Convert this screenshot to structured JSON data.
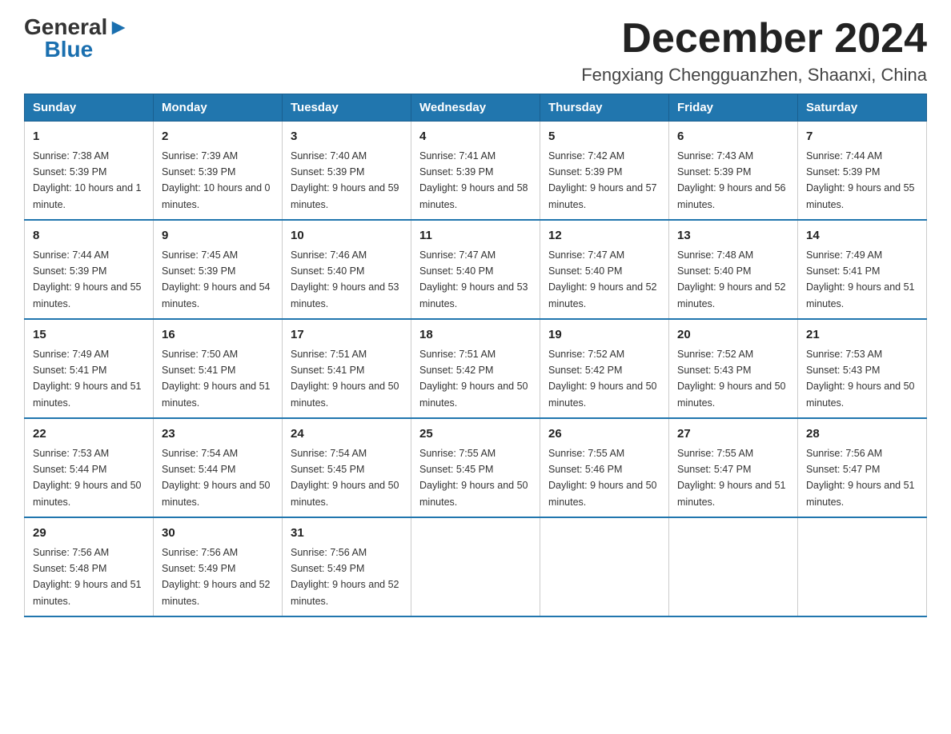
{
  "header": {
    "logo_general": "General",
    "logo_blue": "Blue",
    "month_title": "December 2024",
    "location": "Fengxiang Chengguanzhen, Shaanxi, China"
  },
  "columns": [
    "Sunday",
    "Monday",
    "Tuesday",
    "Wednesday",
    "Thursday",
    "Friday",
    "Saturday"
  ],
  "weeks": [
    [
      {
        "day": "1",
        "sunrise": "7:38 AM",
        "sunset": "5:39 PM",
        "daylight": "10 hours and 1 minute."
      },
      {
        "day": "2",
        "sunrise": "7:39 AM",
        "sunset": "5:39 PM",
        "daylight": "10 hours and 0 minutes."
      },
      {
        "day": "3",
        "sunrise": "7:40 AM",
        "sunset": "5:39 PM",
        "daylight": "9 hours and 59 minutes."
      },
      {
        "day": "4",
        "sunrise": "7:41 AM",
        "sunset": "5:39 PM",
        "daylight": "9 hours and 58 minutes."
      },
      {
        "day": "5",
        "sunrise": "7:42 AM",
        "sunset": "5:39 PM",
        "daylight": "9 hours and 57 minutes."
      },
      {
        "day": "6",
        "sunrise": "7:43 AM",
        "sunset": "5:39 PM",
        "daylight": "9 hours and 56 minutes."
      },
      {
        "day": "7",
        "sunrise": "7:44 AM",
        "sunset": "5:39 PM",
        "daylight": "9 hours and 55 minutes."
      }
    ],
    [
      {
        "day": "8",
        "sunrise": "7:44 AM",
        "sunset": "5:39 PM",
        "daylight": "9 hours and 55 minutes."
      },
      {
        "day": "9",
        "sunrise": "7:45 AM",
        "sunset": "5:39 PM",
        "daylight": "9 hours and 54 minutes."
      },
      {
        "day": "10",
        "sunrise": "7:46 AM",
        "sunset": "5:40 PM",
        "daylight": "9 hours and 53 minutes."
      },
      {
        "day": "11",
        "sunrise": "7:47 AM",
        "sunset": "5:40 PM",
        "daylight": "9 hours and 53 minutes."
      },
      {
        "day": "12",
        "sunrise": "7:47 AM",
        "sunset": "5:40 PM",
        "daylight": "9 hours and 52 minutes."
      },
      {
        "day": "13",
        "sunrise": "7:48 AM",
        "sunset": "5:40 PM",
        "daylight": "9 hours and 52 minutes."
      },
      {
        "day": "14",
        "sunrise": "7:49 AM",
        "sunset": "5:41 PM",
        "daylight": "9 hours and 51 minutes."
      }
    ],
    [
      {
        "day": "15",
        "sunrise": "7:49 AM",
        "sunset": "5:41 PM",
        "daylight": "9 hours and 51 minutes."
      },
      {
        "day": "16",
        "sunrise": "7:50 AM",
        "sunset": "5:41 PM",
        "daylight": "9 hours and 51 minutes."
      },
      {
        "day": "17",
        "sunrise": "7:51 AM",
        "sunset": "5:41 PM",
        "daylight": "9 hours and 50 minutes."
      },
      {
        "day": "18",
        "sunrise": "7:51 AM",
        "sunset": "5:42 PM",
        "daylight": "9 hours and 50 minutes."
      },
      {
        "day": "19",
        "sunrise": "7:52 AM",
        "sunset": "5:42 PM",
        "daylight": "9 hours and 50 minutes."
      },
      {
        "day": "20",
        "sunrise": "7:52 AM",
        "sunset": "5:43 PM",
        "daylight": "9 hours and 50 minutes."
      },
      {
        "day": "21",
        "sunrise": "7:53 AM",
        "sunset": "5:43 PM",
        "daylight": "9 hours and 50 minutes."
      }
    ],
    [
      {
        "day": "22",
        "sunrise": "7:53 AM",
        "sunset": "5:44 PM",
        "daylight": "9 hours and 50 minutes."
      },
      {
        "day": "23",
        "sunrise": "7:54 AM",
        "sunset": "5:44 PM",
        "daylight": "9 hours and 50 minutes."
      },
      {
        "day": "24",
        "sunrise": "7:54 AM",
        "sunset": "5:45 PM",
        "daylight": "9 hours and 50 minutes."
      },
      {
        "day": "25",
        "sunrise": "7:55 AM",
        "sunset": "5:45 PM",
        "daylight": "9 hours and 50 minutes."
      },
      {
        "day": "26",
        "sunrise": "7:55 AM",
        "sunset": "5:46 PM",
        "daylight": "9 hours and 50 minutes."
      },
      {
        "day": "27",
        "sunrise": "7:55 AM",
        "sunset": "5:47 PM",
        "daylight": "9 hours and 51 minutes."
      },
      {
        "day": "28",
        "sunrise": "7:56 AM",
        "sunset": "5:47 PM",
        "daylight": "9 hours and 51 minutes."
      }
    ],
    [
      {
        "day": "29",
        "sunrise": "7:56 AM",
        "sunset": "5:48 PM",
        "daylight": "9 hours and 51 minutes."
      },
      {
        "day": "30",
        "sunrise": "7:56 AM",
        "sunset": "5:49 PM",
        "daylight": "9 hours and 52 minutes."
      },
      {
        "day": "31",
        "sunrise": "7:56 AM",
        "sunset": "5:49 PM",
        "daylight": "9 hours and 52 minutes."
      },
      {
        "day": "",
        "sunrise": "",
        "sunset": "",
        "daylight": ""
      },
      {
        "day": "",
        "sunrise": "",
        "sunset": "",
        "daylight": ""
      },
      {
        "day": "",
        "sunrise": "",
        "sunset": "",
        "daylight": ""
      },
      {
        "day": "",
        "sunrise": "",
        "sunset": "",
        "daylight": ""
      }
    ]
  ]
}
